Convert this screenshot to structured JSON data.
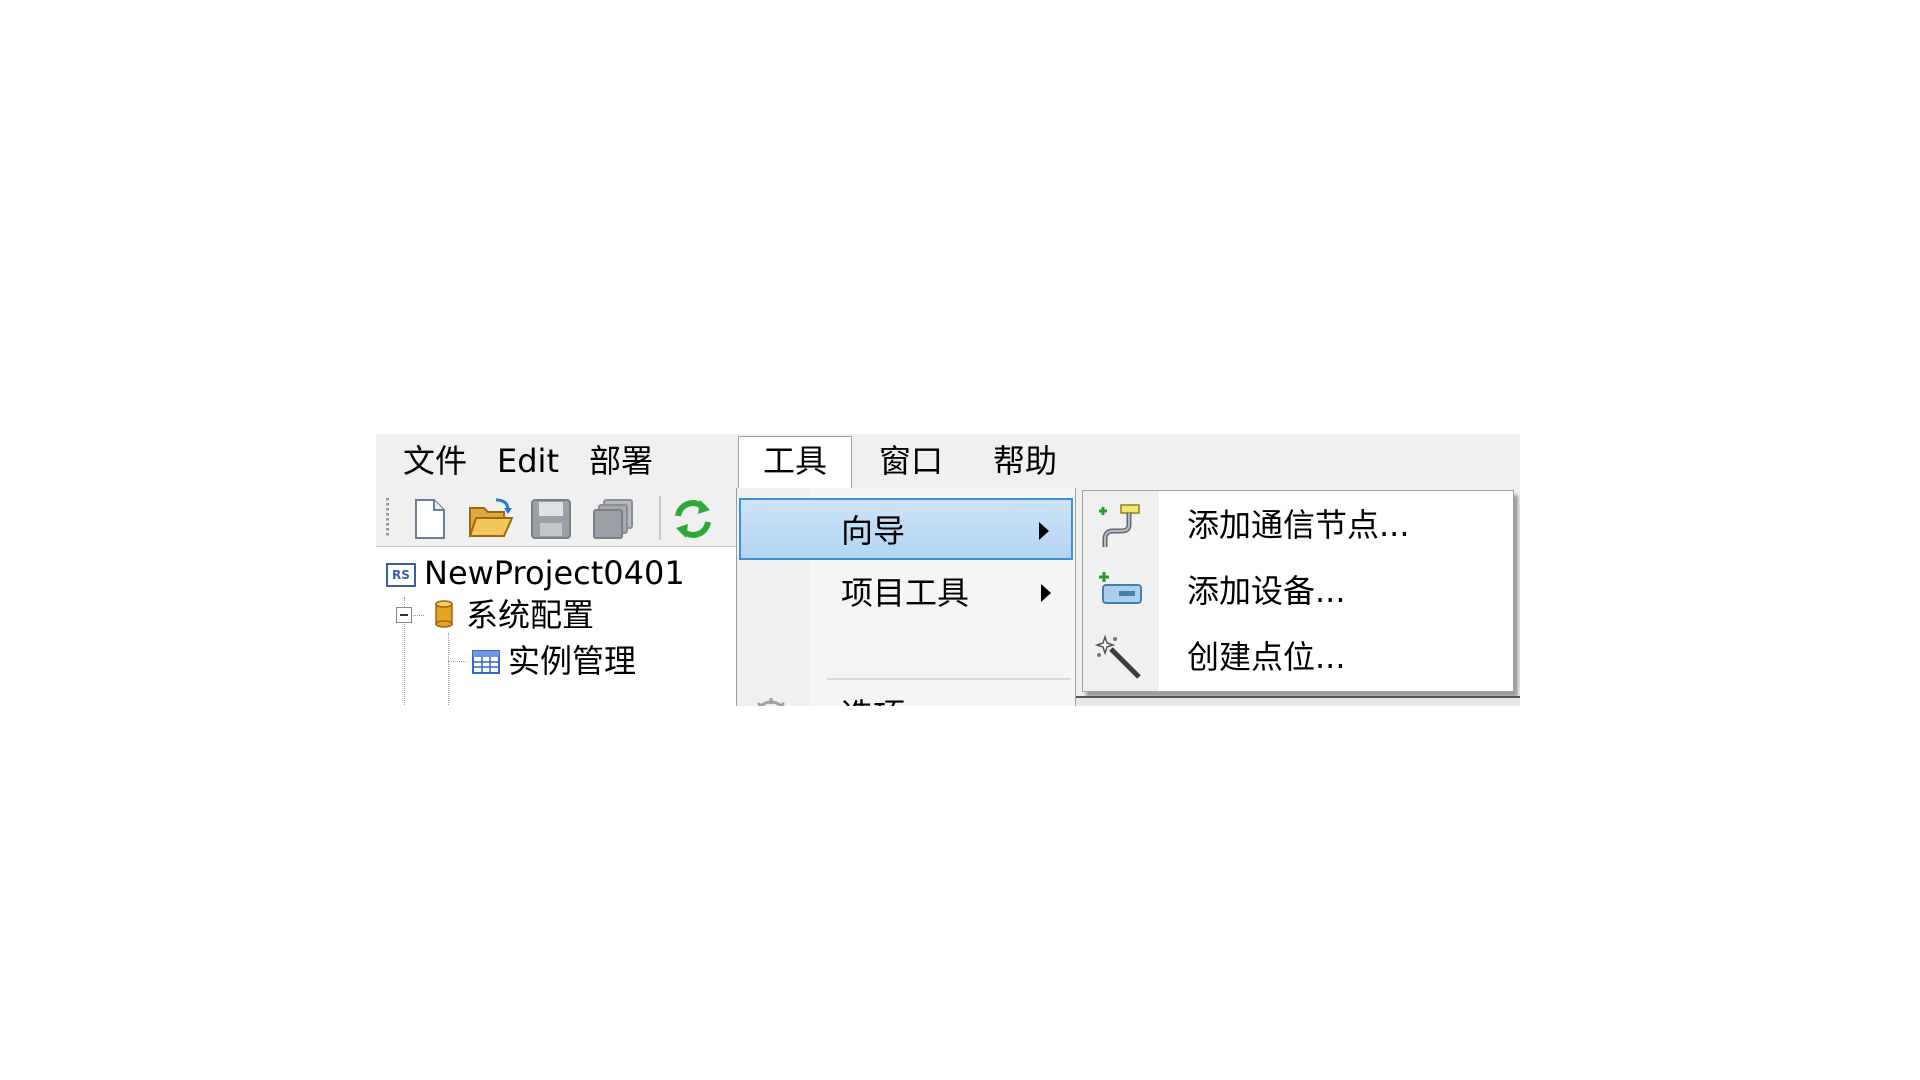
{
  "menubar": {
    "items": [
      {
        "label": "文件"
      },
      {
        "label": "Edit"
      },
      {
        "label": "部署"
      },
      {
        "label": "工具",
        "open": true
      },
      {
        "label": "窗口"
      },
      {
        "label": "帮助"
      }
    ]
  },
  "toolbar": {
    "buttons": [
      {
        "icon": "new-file-icon"
      },
      {
        "icon": "open-folder-icon"
      },
      {
        "icon": "save-icon"
      },
      {
        "icon": "save-all-icon"
      },
      {
        "icon": "refresh-icon"
      }
    ]
  },
  "tree": {
    "root": {
      "badge": "RS",
      "label": "NewProject0401"
    },
    "children": [
      {
        "label": "系统配置",
        "icon": "database-icon"
      },
      {
        "label": "实例管理",
        "icon": "table-icon"
      }
    ]
  },
  "tools_menu": {
    "items": [
      {
        "label": "向导",
        "has_submenu": true,
        "highlighted": true
      },
      {
        "label": "项目工具",
        "has_submenu": true
      },
      {
        "label": "选项...",
        "icon": "gear-icon"
      }
    ]
  },
  "wizard_submenu": {
    "items": [
      {
        "label": "添加通信节点...",
        "icon": "add-comm-node-icon"
      },
      {
        "label": "添加设备...",
        "icon": "add-device-icon"
      },
      {
        "label": "创建点位...",
        "icon": "magic-wand-icon"
      }
    ]
  }
}
